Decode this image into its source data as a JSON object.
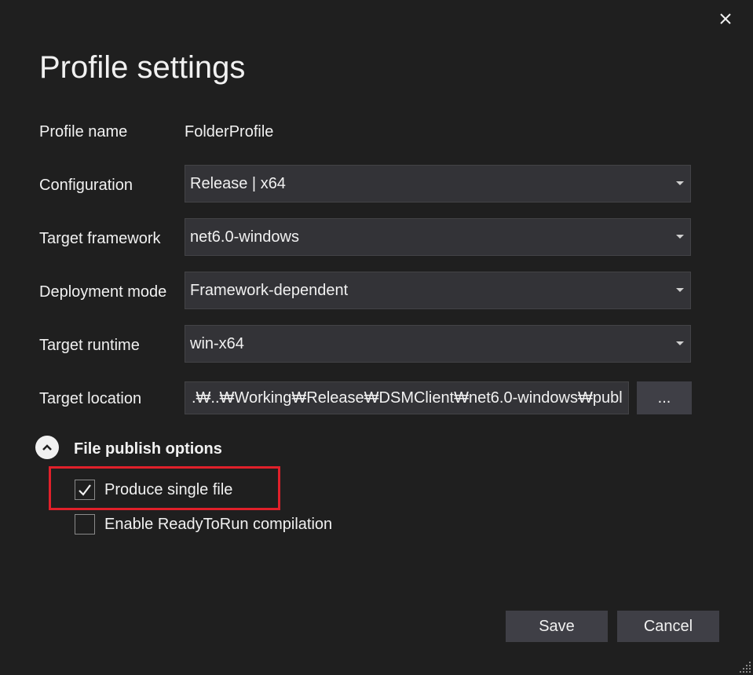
{
  "dialog": {
    "title": "Profile settings"
  },
  "fields": {
    "profile_name_label": "Profile name",
    "profile_name_value": "FolderProfile",
    "configuration_label": "Configuration",
    "configuration_value": "Release | x64",
    "target_framework_label": "Target framework",
    "target_framework_value": "net6.0-windows",
    "deployment_mode_label": "Deployment mode",
    "deployment_mode_value": "Framework-dependent",
    "target_runtime_label": "Target runtime",
    "target_runtime_value": "win-x64",
    "target_location_label": "Target location",
    "target_location_value": ".₩..₩Working₩Release₩DSMClient₩net6.0-windows₩publ",
    "browse_label": "..."
  },
  "publish_options": {
    "section_title": "File publish options",
    "produce_single_file_label": "Produce single file",
    "produce_single_file_checked": true,
    "ready_to_run_label": "Enable ReadyToRun compilation",
    "ready_to_run_checked": false
  },
  "footer": {
    "save_label": "Save",
    "cancel_label": "Cancel"
  },
  "colors": {
    "background": "#1f1f1f",
    "input_bg": "#333337",
    "button_bg": "#3f3f46",
    "highlight": "#e0202a",
    "text": "#f1f1f1"
  },
  "icons": {
    "close": "close-icon",
    "expander": "chevron-up-icon",
    "dropdown": "caret-down-icon",
    "check": "check-icon",
    "resize": "resize-grip-icon"
  }
}
